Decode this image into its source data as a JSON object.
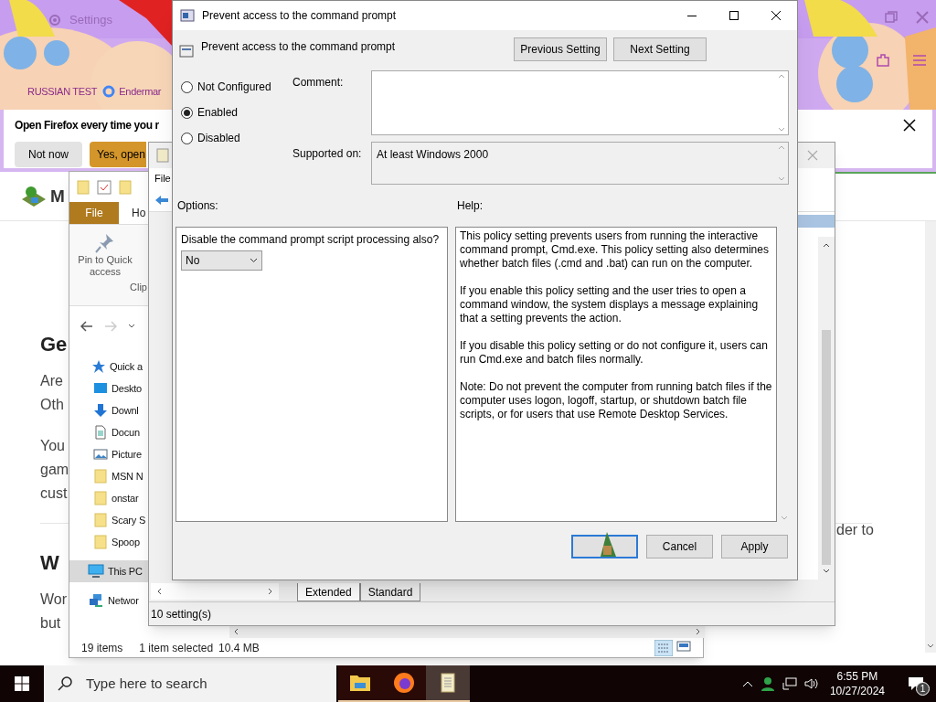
{
  "browser": {
    "tab_label": "Settings",
    "bookmarks": [
      {
        "label": "RUSSIAN TEST",
        "kind": "folder"
      },
      {
        "label": "Endermar",
        "kind": "google"
      }
    ],
    "notification": {
      "message": "Open Firefox every time you r",
      "buttons": [
        {
          "label": "Not now",
          "kind": "secondary"
        },
        {
          "label": "Yes, open",
          "kind": "primary"
        }
      ]
    },
    "page": {
      "site_title": "M",
      "blocks": [
        {
          "kind": "heading",
          "text": "Ge"
        },
        {
          "kind": "paragraph",
          "lines": [
            "Are",
            "Oth"
          ]
        },
        {
          "kind": "paragraph",
          "lines": [
            "You",
            "gam",
            "cust"
          ]
        },
        {
          "kind": "rule"
        },
        {
          "kind": "heading",
          "text": "W"
        },
        {
          "kind": "paragraph",
          "lines": [
            "Wor",
            "but"
          ]
        }
      ],
      "right_text": "der to"
    }
  },
  "explorer": {
    "ribbon_tabs": [
      {
        "label": "File",
        "selected": true
      },
      {
        "label": "Ho",
        "selected": false
      }
    ],
    "ribbon_button": "Pin to Quick access",
    "group_label": "Clip",
    "nav_items": [
      {
        "label": "Quick a",
        "kind": "star",
        "selected": false
      },
      {
        "label": "Deskto",
        "kind": "desktop",
        "selected": false
      },
      {
        "label": "Downl",
        "kind": "download",
        "selected": false
      },
      {
        "label": "Docun",
        "kind": "document",
        "selected": false
      },
      {
        "label": "Picture",
        "kind": "pictures",
        "selected": false
      },
      {
        "label": "MSN N",
        "kind": "folder",
        "selected": false
      },
      {
        "label": "onstar",
        "kind": "folder",
        "selected": false
      },
      {
        "label": "Scary S",
        "kind": "folder",
        "selected": false
      },
      {
        "label": "Spoop",
        "kind": "folder",
        "selected": false
      },
      {
        "label": "This PC",
        "kind": "pc",
        "selected": true
      },
      {
        "label": "Networ",
        "kind": "network",
        "selected": false
      }
    ],
    "status": [
      "19 items",
      "1 item selected",
      "10.4 MB"
    ]
  },
  "editor": {
    "menu": [
      "File"
    ],
    "tabs": [
      {
        "label": "Extended",
        "selected": true
      },
      {
        "label": "Standard",
        "selected": false
      }
    ],
    "status": "10 setting(s)"
  },
  "dialog": {
    "title": "Prevent access to the command prompt",
    "heading": "Prevent access to the command prompt",
    "nav_buttons": [
      "Previous Setting",
      "Next Setting"
    ],
    "states": [
      {
        "label": "Not Configured",
        "selected": false
      },
      {
        "label": "Enabled",
        "selected": true
      },
      {
        "label": "Disabled",
        "selected": false
      }
    ],
    "comment_label": "Comment:",
    "supported_label": "Supported on:",
    "supported_value": "At least Windows 2000",
    "options_label": "Options:",
    "help_label": "Help:",
    "option": {
      "question": "Disable the command prompt script processing also?",
      "value": "No"
    },
    "help": [
      "This policy setting prevents users from running the interactive command prompt, Cmd.exe.  This policy setting also determines whether batch files (.cmd and .bat) can run on the computer.",
      "If you enable this policy setting and the user tries to open a command window, the system displays a message explaining that a setting prevents the action.",
      "If you disable this policy setting or do not configure it, users can run Cmd.exe and batch files normally.",
      "Note: Do not prevent the computer from running batch files if the computer uses logon, logoff, startup, or shutdown batch file scripts, or for users that use Remote Desktop Services."
    ],
    "buttons": [
      "Cancel",
      "Apply"
    ]
  },
  "taskbar": {
    "search_placeholder": "Type here to search",
    "apps": [
      {
        "kind": "explorer",
        "selected": false
      },
      {
        "kind": "firefox",
        "selected": false
      },
      {
        "kind": "notepad",
        "selected": true
      }
    ],
    "time": "6:55 PM",
    "date": "10/27/2024",
    "notifications": "1"
  }
}
